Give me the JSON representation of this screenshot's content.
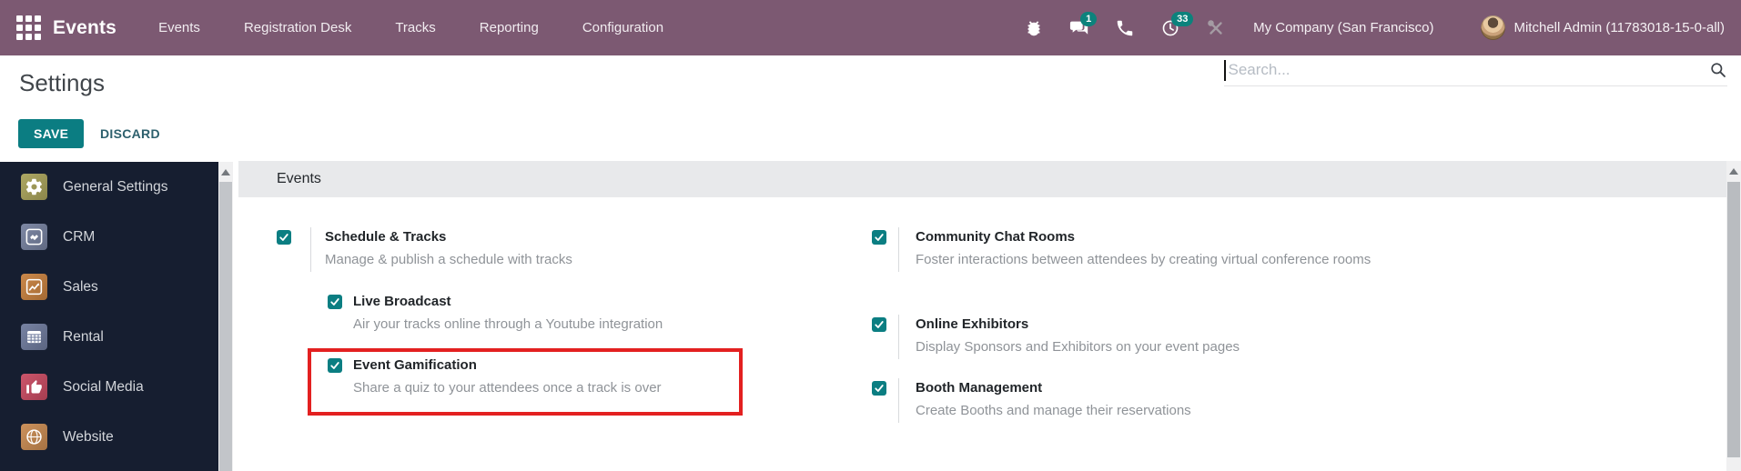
{
  "topbar": {
    "app_name": "Events",
    "menu": [
      "Events",
      "Registration Desk",
      "Tracks",
      "Reporting",
      "Configuration"
    ],
    "systray": {
      "chat_badge": "1",
      "activity_badge": "33"
    },
    "company": "My Company (San Francisco)",
    "user": "Mitchell Admin (11783018-15-0-all)"
  },
  "control_panel": {
    "title": "Settings",
    "save_label": "SAVE",
    "discard_label": "DISCARD",
    "search_placeholder": "Search..."
  },
  "sidebar": {
    "items": [
      {
        "label": "General Settings",
        "color": "#a9a35b"
      },
      {
        "label": "CRM",
        "color": "#76819f"
      },
      {
        "label": "Sales",
        "color": "#c8813f"
      },
      {
        "label": "Rental",
        "color": "#6f7b9d"
      },
      {
        "label": "Social Media",
        "color": "#c94b62"
      },
      {
        "label": "Website",
        "color": "#c98b52"
      }
    ]
  },
  "main": {
    "section_title": "Events",
    "settings_left": [
      {
        "label": "Schedule & Tracks",
        "description": "Manage & publish a schedule with tracks",
        "checked": true
      },
      {
        "label": "Live Broadcast",
        "description": "Air your tracks online through a Youtube integration",
        "checked": true
      },
      {
        "label": "Event Gamification",
        "description": "Share a quiz to your attendees once a track is over",
        "checked": true,
        "highlighted": true
      }
    ],
    "settings_right": [
      {
        "label": "Community Chat Rooms",
        "description": "Foster interactions between attendees by creating virtual conference rooms",
        "checked": true
      },
      {
        "label": "Online Exhibitors",
        "description": "Display Sponsors and Exhibitors on your event pages",
        "checked": true
      },
      {
        "label": "Booth Management",
        "description": "Create Booths and manage their reservations",
        "checked": true
      }
    ]
  },
  "colors": {
    "topbar_bg": "#7c5972",
    "accent_teal": "#0b7e82",
    "badge_teal": "#0c827c",
    "highlight_red": "#e32020",
    "sidebar_bg": "#161e30",
    "section_header_bg": "#e8e9eb"
  }
}
